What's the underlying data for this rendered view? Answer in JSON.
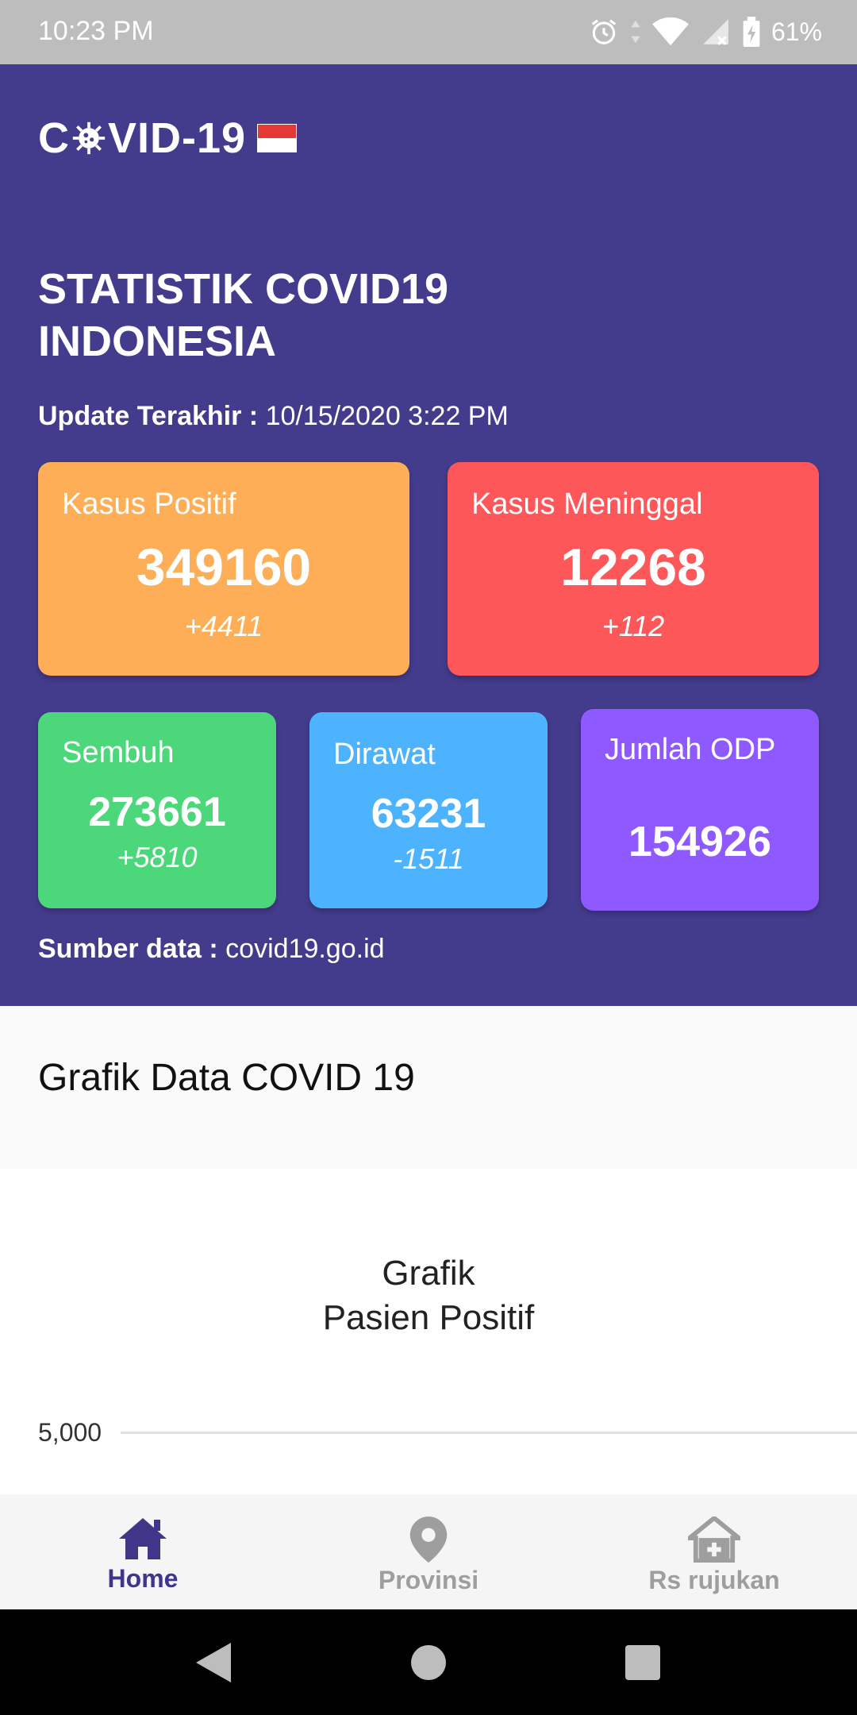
{
  "status_bar": {
    "time": "10:23 PM",
    "battery": "61%",
    "icons": [
      "alarm-icon",
      "data-arrows-icon",
      "wifi-icon",
      "signal-icon",
      "battery-charging-icon"
    ]
  },
  "header": {
    "logo_text_left": "C",
    "logo_text_right": "VID-19",
    "logo_icons": [
      "virus-icon",
      "indonesia-flag-icon"
    ],
    "title": "STATISTIK COVID19 INDONESIA",
    "update_label": "Update Terakhir :",
    "update_value": "10/15/2020 3:22 PM",
    "source_label": "Sumber data :",
    "source_value": "covid19.go.id"
  },
  "stats": {
    "positive": {
      "label": "Kasus Positif",
      "value": "349160",
      "delta": "+4411",
      "color": "#fdae56"
    },
    "deaths": {
      "label": "Kasus Meninggal",
      "value": "12268",
      "delta": "+112",
      "color": "#fe5759"
    },
    "recovered": {
      "label": "Sembuh",
      "value": "273661",
      "delta": "+5810",
      "color": "#4dd77b"
    },
    "treated": {
      "label": "Dirawat",
      "value": "63231",
      "delta": "-1511",
      "color": "#4db3fe"
    },
    "odp": {
      "label": "Jumlah ODP",
      "value": "154926",
      "color": "#8e59fe"
    }
  },
  "chart_section": {
    "heading": "Grafik Data COVID 19"
  },
  "chart_data": {
    "type": "line",
    "title_line1": "Grafik",
    "title_line2": "Pasien Positif",
    "y_ticks": [
      "5,000"
    ],
    "grid": true
  },
  "bottom_nav": {
    "items": [
      {
        "label": "Home",
        "icon": "home-icon",
        "active": true
      },
      {
        "label": "Provinsi",
        "icon": "location-pin-icon",
        "active": false
      },
      {
        "label": "Rs rujukan",
        "icon": "hospital-icon",
        "active": false
      }
    ],
    "active_color": "#3f3589",
    "inactive_color": "#9e9e9e"
  },
  "system_nav": {
    "icons": [
      "back-icon",
      "home-circle-icon",
      "recents-icon"
    ]
  },
  "colors": {
    "primary": "#433b8b",
    "status_bar": "#bdbdbd"
  }
}
